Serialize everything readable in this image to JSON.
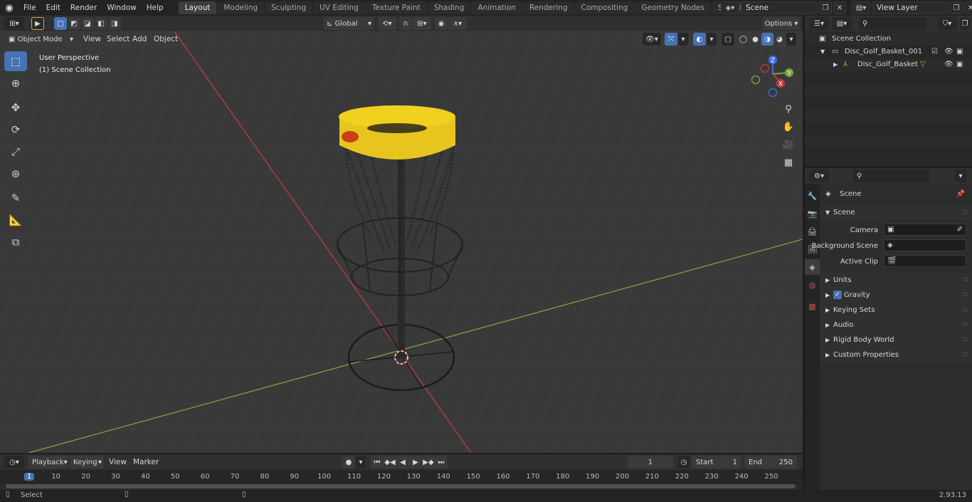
{
  "topbar": {
    "menus": [
      "File",
      "Edit",
      "Render",
      "Window",
      "Help"
    ],
    "workspaces": [
      "Layout",
      "Modeling",
      "Sculpting",
      "UV Editing",
      "Texture Paint",
      "Shading",
      "Animation",
      "Rendering",
      "Compositing",
      "Geometry Nodes",
      "Scripting"
    ],
    "active_workspace": "Layout",
    "scene": "Scene",
    "view_layer": "View Layer"
  },
  "viewport_header": {
    "mode": "Object Mode",
    "menus": [
      "View",
      "Select",
      "Add",
      "Object"
    ],
    "orientation": "Global",
    "options": "Options"
  },
  "viewport": {
    "perspective": "User Perspective",
    "collection": "(1) Scene Collection",
    "gizmo": {
      "x": "X",
      "y": "Y",
      "z": "Z"
    }
  },
  "timeline": {
    "menus": [
      "Playback",
      "Keying",
      "View",
      "Marker"
    ],
    "current_frame": "1",
    "start_label": "Start",
    "start": "1",
    "end_label": "End",
    "end": "250",
    "ticks": [
      "1",
      "10",
      "20",
      "30",
      "40",
      "50",
      "60",
      "70",
      "80",
      "90",
      "100",
      "110",
      "120",
      "130",
      "140",
      "150",
      "160",
      "170",
      "180",
      "190",
      "200",
      "210",
      "220",
      "230",
      "240",
      "250"
    ]
  },
  "statusbar": {
    "left": "Select",
    "version": "2.93.13"
  },
  "outliner": {
    "root": "Scene Collection",
    "items": [
      {
        "name": "Disc_Golf_Basket_001"
      },
      {
        "name": "Disc_Golf_Basket"
      }
    ]
  },
  "properties": {
    "context": "Scene",
    "panel": "Scene",
    "fields": [
      {
        "label": "Camera"
      },
      {
        "label": "Background Scene"
      },
      {
        "label": "Active Clip"
      }
    ],
    "sections": [
      "Units",
      "Gravity",
      "Keying Sets",
      "Audio",
      "Rigid Body World",
      "Custom Properties"
    ]
  },
  "colors": {
    "accent": "#4772b3",
    "basket_yellow": "#e8c51e",
    "x_axis": "#c23b3b",
    "y_axis": "#7fa33a"
  }
}
